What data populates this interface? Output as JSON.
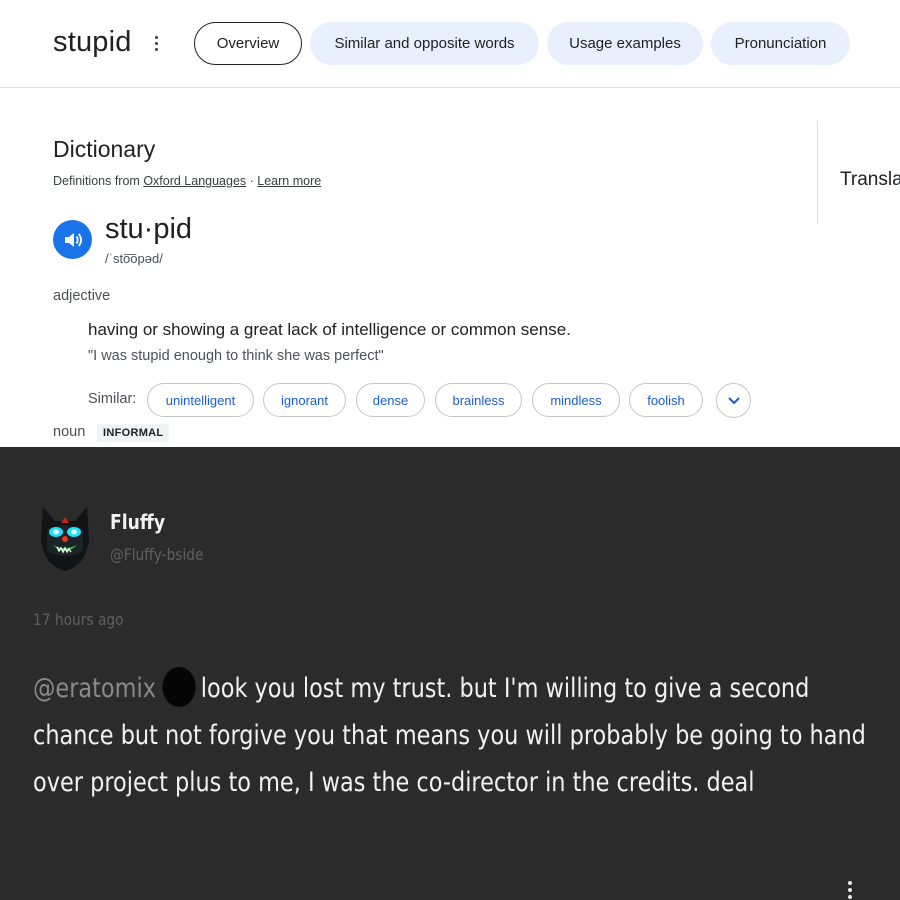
{
  "search": {
    "query": "stupid",
    "tabs": [
      {
        "label": "Overview",
        "active": true
      },
      {
        "label": "Similar and opposite words"
      },
      {
        "label": "Usage examples"
      },
      {
        "label": "Pronunciation"
      }
    ]
  },
  "dictionary": {
    "title": "Dictionary",
    "source_prefix": "Definitions from ",
    "source_link": "Oxford Languages",
    "source_sep": " · ",
    "learn_more": "Learn more",
    "translate": "Transla",
    "headword": "stu·pid",
    "phonetic": "/ˈsto͞opəd/",
    "pos1": "adjective",
    "definition": "having or showing a great lack of intelligence or common sense.",
    "example": "\"I was stupid enough to think she was perfect\"",
    "similar_label": "Similar:",
    "similar": [
      "unintelligent",
      "ignorant",
      "dense",
      "brainless",
      "mindless",
      "foolish"
    ],
    "pos2": "noun",
    "badge": "INFORMAL"
  },
  "comment": {
    "username": "Fluffy",
    "handle": "@Fluffy-bside",
    "time": "17 hours ago",
    "mention": "@eratomix",
    "line1": "look you lost my trust. but I'm willing to give a second",
    "line2": "chance but not forgive you that means you will probably be going to hand",
    "line3": "over project plus to me, I was the co-director in the credits. deal"
  },
  "colors": {
    "accent_blue": "#1a73e8",
    "chip_text": "#1a5fc7",
    "tab_bg": "#e8f0fe",
    "comment_bg": "#2b2b2b",
    "avatar_glow": "#1fe0ff"
  },
  "icons": [
    "more-vert-icon",
    "speaker-icon",
    "chevron-down-icon"
  ]
}
